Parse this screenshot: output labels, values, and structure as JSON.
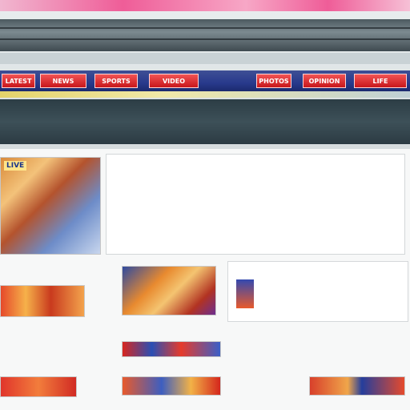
{
  "nav": {
    "tabs": [
      {
        "label": "LATEST"
      },
      {
        "label": "NEWS"
      },
      {
        "label": "SPORTS"
      },
      {
        "label": "VIDEO"
      },
      {
        "label": "PHOTOS"
      },
      {
        "label": "OPINION"
      },
      {
        "label": "LIFE"
      }
    ]
  },
  "subnav": {
    "line1": "",
    "line2": ""
  },
  "hero": {
    "image_caption": "LIVE",
    "lines": []
  },
  "card": {
    "head": "",
    "lines": []
  },
  "labels": {
    "d": "",
    "f": "",
    "footer": ""
  }
}
